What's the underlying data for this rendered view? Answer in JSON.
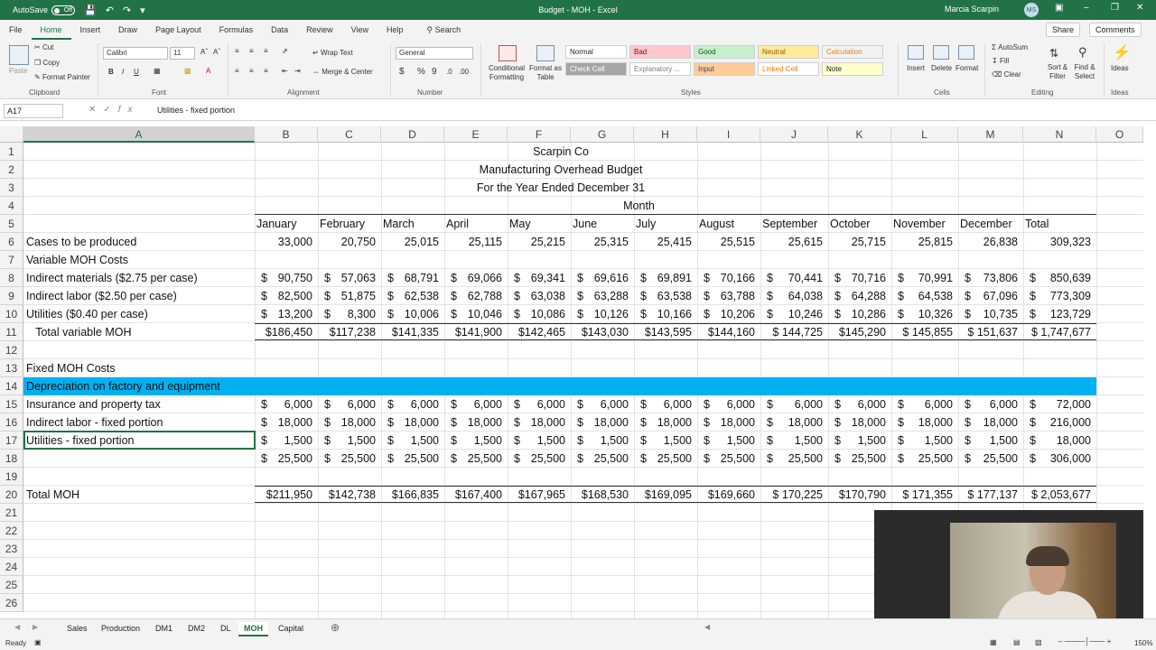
{
  "titlebar": {
    "autosave_label": "AutoSave",
    "autosave_state": "Off",
    "doc_title": "Budget - MOH  -  Excel",
    "user_name": "Marcia Scarpin",
    "user_initials": "MS"
  },
  "ribbon_tabs": [
    "File",
    "Home",
    "Insert",
    "Draw",
    "Page Layout",
    "Formulas",
    "Data",
    "Review",
    "View",
    "Help"
  ],
  "search_label": "Search",
  "share_label": "Share",
  "comments_label": "Comments",
  "ribbon": {
    "clipboard": {
      "paste": "Paste",
      "cut": "Cut",
      "copy": "Copy",
      "format_painter": "Format Painter",
      "group": "Clipboard"
    },
    "font": {
      "name": "Calibri",
      "size": "11",
      "group": "Font"
    },
    "alignment": {
      "wrap": "Wrap Text",
      "merge": "Merge & Center",
      "group": "Alignment"
    },
    "number": {
      "format": "General",
      "group": "Number"
    },
    "styles": {
      "conditional": "Conditional Formatting",
      "format_table": "Format as Table",
      "cells": [
        {
          "label": "Normal",
          "bg": "#ffffff",
          "fg": "#222222"
        },
        {
          "label": "Bad",
          "bg": "#ffc7ce",
          "fg": "#9c0006"
        },
        {
          "label": "Good",
          "bg": "#c6efce",
          "fg": "#006100"
        },
        {
          "label": "Neutral",
          "bg": "#ffeb9c",
          "fg": "#9c5700"
        },
        {
          "label": "Calculation",
          "bg": "#f2f2f2",
          "fg": "#fa7d00"
        },
        {
          "label": "Check Cell",
          "bg": "#a5a5a5",
          "fg": "#ffffff"
        },
        {
          "label": "Explanatory ...",
          "bg": "#ffffff",
          "fg": "#7f7f7f"
        },
        {
          "label": "Input",
          "bg": "#ffcc99",
          "fg": "#3f3f76"
        },
        {
          "label": "Linked Cell",
          "bg": "#ffffff",
          "fg": "#fa7d00"
        },
        {
          "label": "Note",
          "bg": "#ffffcc",
          "fg": "#222222"
        }
      ],
      "group": "Styles"
    },
    "cells": {
      "insert": "Insert",
      "delete": "Delete",
      "format": "Format",
      "group": "Cells"
    },
    "editing": {
      "autosum": "AutoSum",
      "fill": "Fill",
      "clear": "Clear",
      "sort": "Sort & Filter",
      "find": "Find & Select",
      "group": "Editing"
    },
    "ideas": {
      "label": "Ideas",
      "group": "Ideas"
    }
  },
  "formula_bar": {
    "name_box": "A17",
    "formula": "Utilities - fixed portion"
  },
  "columns": [
    "A",
    "B",
    "C",
    "D",
    "E",
    "F",
    "G",
    "H",
    "I",
    "J",
    "K",
    "L",
    "M",
    "N",
    "O"
  ],
  "selected_column": "A",
  "rows": [
    {
      "n": "1",
      "a": "",
      "center": "Scarpin Co"
    },
    {
      "n": "2",
      "a": "",
      "center": "Manufacturing Overhead Budget"
    },
    {
      "n": "3",
      "a": "",
      "center": "For the Year Ended December 31"
    },
    {
      "n": "4",
      "a": "",
      "center_month": "Month"
    },
    {
      "n": "5",
      "a": "",
      "months": [
        "January",
        "February",
        "March",
        "April",
        "May",
        "June",
        "July",
        "August",
        "September",
        "October",
        "November",
        "December",
        "Total"
      ]
    },
    {
      "n": "6",
      "a": "Cases to be produced",
      "plain": [
        "33,000",
        "20,750",
        "25,015",
        "25,115",
        "25,215",
        "25,315",
        "25,415",
        "25,515",
        "25,615",
        "25,715",
        "25,815",
        "26,838",
        "309,323"
      ]
    },
    {
      "n": "7",
      "a": "Variable MOH Costs"
    },
    {
      "n": "8",
      "a": "Indirect materials ($2.75 per case)",
      "dollars": [
        "90,750",
        "57,063",
        "68,791",
        "69,066",
        "69,341",
        "69,616",
        "69,891",
        "70,166",
        "70,441",
        "70,716",
        "70,991",
        "73,806",
        "850,639"
      ]
    },
    {
      "n": "9",
      "a": "Indirect labor ($2.50 per case)",
      "dollars": [
        "82,500",
        "51,875",
        "62,538",
        "62,788",
        "63,038",
        "63,288",
        "63,538",
        "63,788",
        "64,038",
        "64,288",
        "64,538",
        "67,096",
        "773,309"
      ]
    },
    {
      "n": "10",
      "a": "Utilities ($0.40 per case)",
      "dollars": [
        "13,200",
        "8,300",
        "10,006",
        "10,046",
        "10,086",
        "10,126",
        "10,166",
        "10,206",
        "10,246",
        "10,286",
        "10,326",
        "10,735",
        "123,729"
      ]
    },
    {
      "n": "11",
      "a": "   Total variable MOH",
      "totals": [
        "$186,450",
        "$117,238",
        "$141,335",
        "$141,900",
        "$142,465",
        "$143,030",
        "$143,595",
        "$144,160",
        "$ 144,725",
        "$145,290",
        "$ 145,855",
        "$ 151,637",
        "$ 1,747,677"
      ]
    },
    {
      "n": "12",
      "a": ""
    },
    {
      "n": "13",
      "a": "Fixed MOH Costs"
    },
    {
      "n": "14",
      "a": "Depreciation on factory and equipment",
      "banner": true
    },
    {
      "n": "15",
      "a": "Insurance and property tax",
      "dollars": [
        "6,000",
        "6,000",
        "6,000",
        "6,000",
        "6,000",
        "6,000",
        "6,000",
        "6,000",
        "6,000",
        "6,000",
        "6,000",
        "6,000",
        "72,000"
      ]
    },
    {
      "n": "16",
      "a": "Indirect labor - fixed portion",
      "dollars": [
        "18,000",
        "18,000",
        "18,000",
        "18,000",
        "18,000",
        "18,000",
        "18,000",
        "18,000",
        "18,000",
        "18,000",
        "18,000",
        "18,000",
        "216,000"
      ]
    },
    {
      "n": "17",
      "a": "Utilities - fixed portion",
      "dollars": [
        "1,500",
        "1,500",
        "1,500",
        "1,500",
        "1,500",
        "1,500",
        "1,500",
        "1,500",
        "1,500",
        "1,500",
        "1,500",
        "1,500",
        "18,000"
      ],
      "active": true
    },
    {
      "n": "18",
      "a": "",
      "dollars": [
        "25,500",
        "25,500",
        "25,500",
        "25,500",
        "25,500",
        "25,500",
        "25,500",
        "25,500",
        "25,500",
        "25,500",
        "25,500",
        "25,500",
        "306,000"
      ]
    },
    {
      "n": "19",
      "a": ""
    },
    {
      "n": "20",
      "a": "Total MOH",
      "totals": [
        "$211,950",
        "$142,738",
        "$166,835",
        "$167,400",
        "$167,965",
        "$168,530",
        "$169,095",
        "$169,660",
        "$ 170,225",
        "$170,790",
        "$ 171,355",
        "$ 177,137",
        "$ 2,053,677"
      ]
    },
    {
      "n": "21",
      "a": ""
    },
    {
      "n": "22",
      "a": ""
    },
    {
      "n": "23",
      "a": ""
    },
    {
      "n": "24",
      "a": ""
    },
    {
      "n": "25",
      "a": ""
    },
    {
      "n": "26",
      "a": ""
    }
  ],
  "sheets": [
    "Sales",
    "Production",
    "DM1",
    "DM2",
    "DL",
    "MOH",
    "Capital"
  ],
  "active_sheet": "MOH",
  "status": {
    "ready": "Ready",
    "zoom": "150%"
  },
  "colors": {
    "accent": "#217346",
    "banner": "#00b0f0"
  }
}
